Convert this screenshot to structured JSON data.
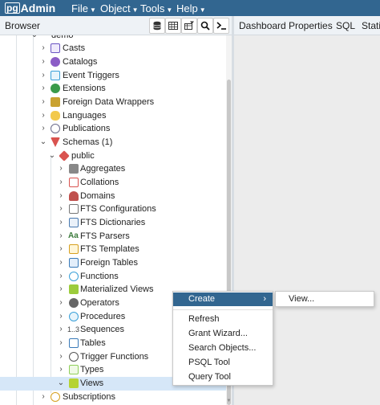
{
  "navbar": {
    "logo_pg": "pg",
    "logo_admin": "Admin",
    "menus": [
      "File",
      "Object",
      "Tools",
      "Help"
    ]
  },
  "browser": {
    "title": "Browser",
    "toolbar_icons": [
      "database-icon",
      "table-icon",
      "filter-table-icon",
      "search-icon",
      "terminal-icon"
    ]
  },
  "tabs": [
    "Dashboard",
    "Properties",
    "SQL",
    "Statistics"
  ],
  "tree": {
    "database": "demo",
    "db_children": [
      "Casts",
      "Catalogs",
      "Event Triggers",
      "Extensions",
      "Foreign Data Wrappers",
      "Languages",
      "Publications"
    ],
    "schemas": "Schemas (1)",
    "schema": "public",
    "schema_children": [
      "Aggregates",
      "Collations",
      "Domains",
      "FTS Configurations",
      "FTS Dictionaries",
      "FTS Parsers",
      "FTS Templates",
      "Foreign Tables",
      "Functions",
      "Materialized Views",
      "Operators",
      "Procedures",
      "Sequences",
      "Tables",
      "Trigger Functions",
      "Types",
      "Views"
    ],
    "after": "Subscriptions",
    "fts_parsers_glyph": "Aa",
    "sequences_glyph": "1..3",
    "selected": "Views"
  },
  "context_menu": {
    "create": "Create",
    "items": [
      "Refresh",
      "Grant Wizard...",
      "Search Objects...",
      "PSQL Tool",
      "Query Tool"
    ],
    "submenu": [
      "View..."
    ]
  },
  "colors": {
    "brand": "#326690",
    "selection": "#d6e7f8"
  }
}
